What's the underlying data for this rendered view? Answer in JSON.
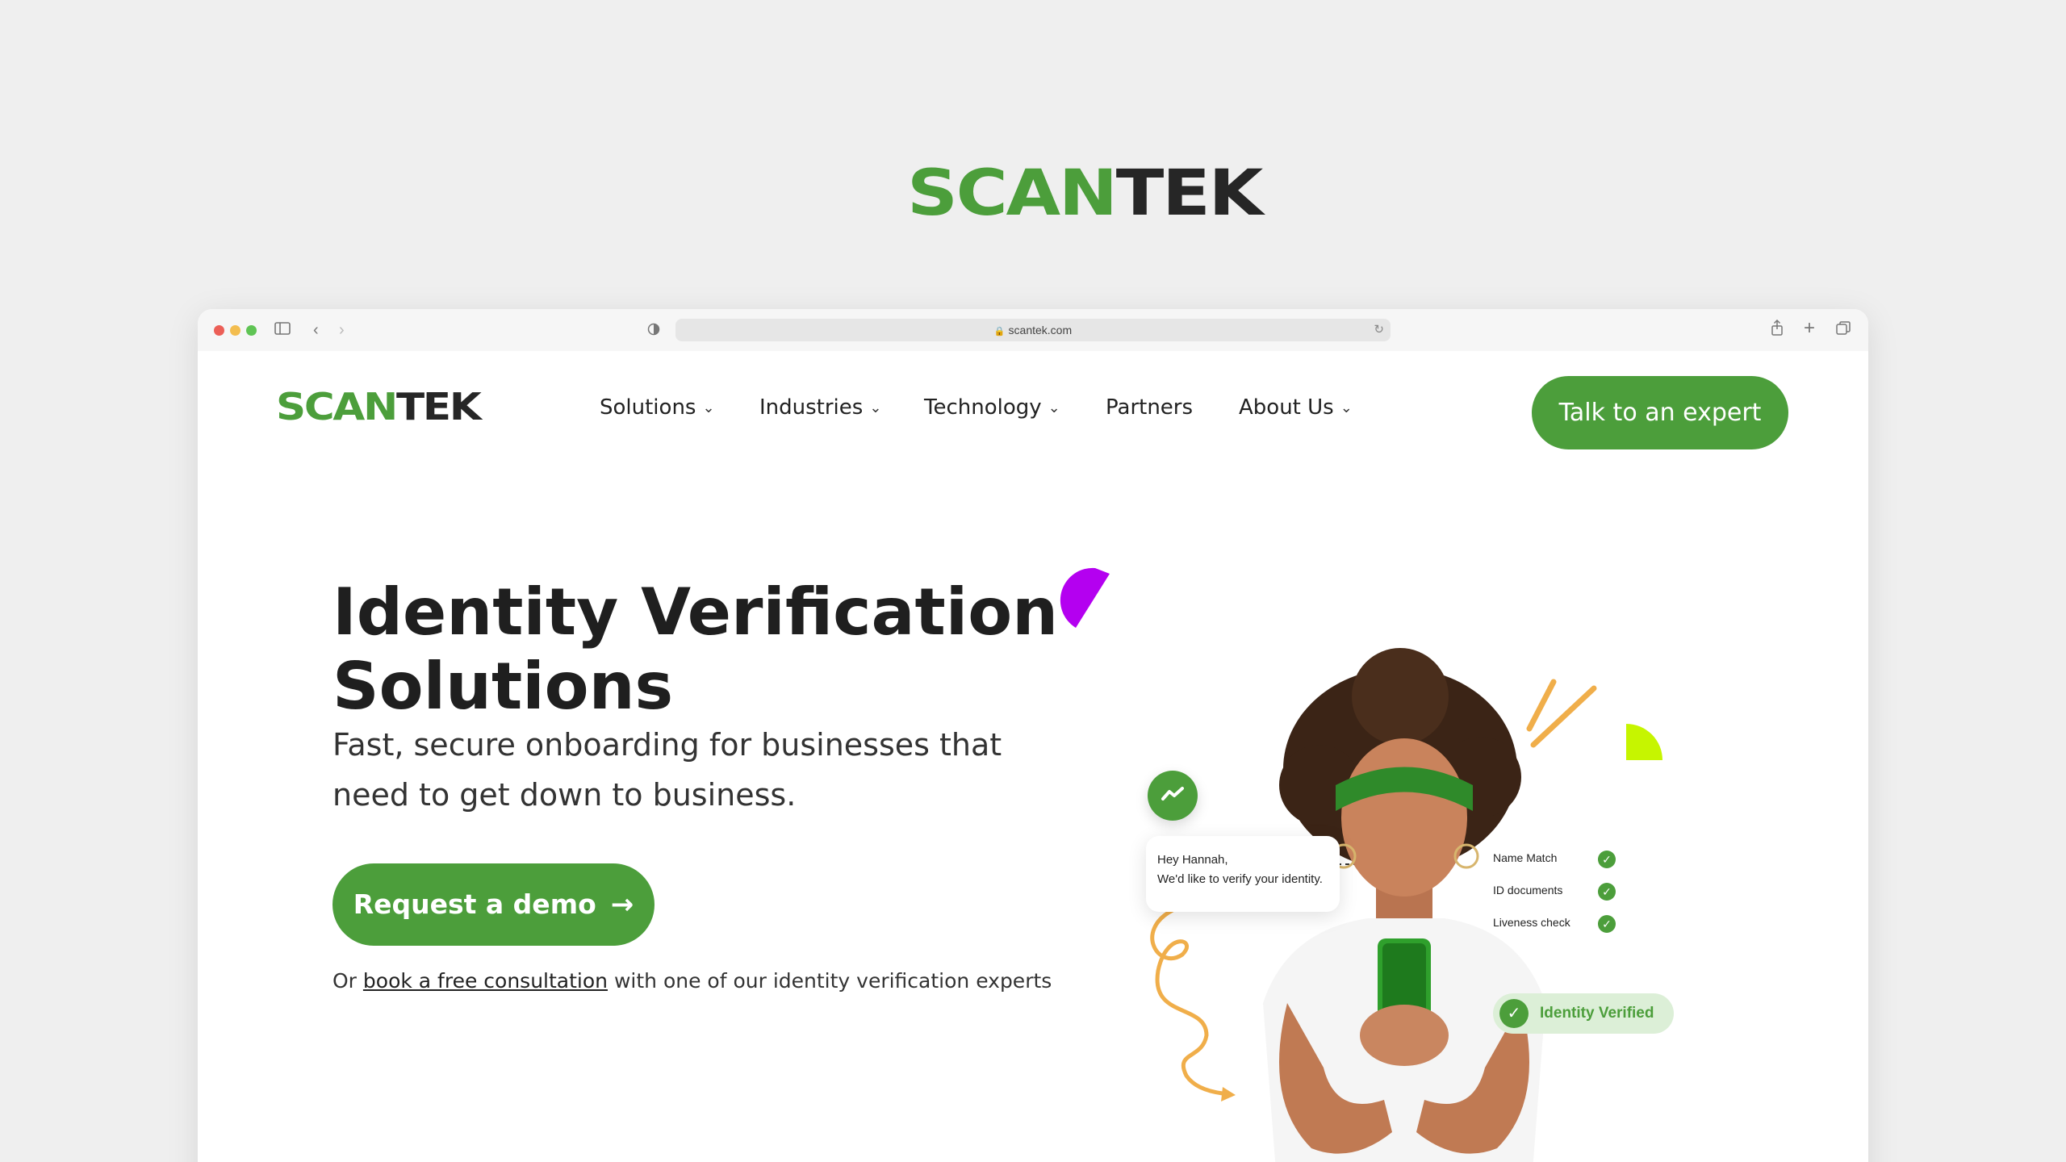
{
  "brand": {
    "part1": "SCAN",
    "part2": "TEK"
  },
  "browser": {
    "url": "scantek.com",
    "lock_icon": "lock-icon",
    "icons": [
      "sidebar-icon",
      "back-icon",
      "forward-icon",
      "privacy-icon",
      "reload-icon",
      "share-icon",
      "new-tab-icon",
      "tabs-overview-icon"
    ]
  },
  "nav": {
    "items": [
      {
        "label": "Solutions",
        "has_dropdown": true
      },
      {
        "label": "Industries",
        "has_dropdown": true
      },
      {
        "label": "Technology",
        "has_dropdown": true
      },
      {
        "label": "Partners",
        "has_dropdown": false
      },
      {
        "label": "About Us",
        "has_dropdown": true
      }
    ],
    "cta": "Talk to an expert"
  },
  "hero": {
    "title_line1": "Identity Verification",
    "title_line2": "Solutions",
    "subtitle_line1": "Fast, secure onboarding for businesses that",
    "subtitle_line2": "need to get down to business.",
    "demo_button": "Request a demo",
    "consult_prefix": "Or ",
    "consult_link": "book a free consultation",
    "consult_suffix": " with one of our identity verification experts"
  },
  "illustration": {
    "chat_line1": "Hey Hannah,",
    "chat_line2": "We'd like to verify your identity.",
    "checks": [
      "Name Match",
      "ID documents",
      "Liveness check"
    ],
    "verified": "Identity Verified"
  },
  "colors": {
    "brand_green": "#4c9e3b",
    "dark": "#262626",
    "accent_purple": "#b400f0",
    "accent_lime": "#c6f500",
    "accent_orange": "#f0ae4a"
  }
}
